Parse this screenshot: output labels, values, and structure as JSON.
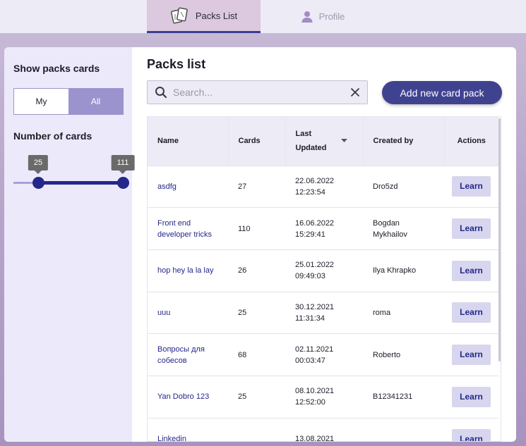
{
  "nav": {
    "tabs": [
      {
        "label": "Packs List",
        "icon": "cards-icon",
        "active": true
      },
      {
        "label": "Profile",
        "icon": "user-icon",
        "active": false
      }
    ]
  },
  "sidebar": {
    "title": "Show packs cards",
    "toggle": {
      "my": "My",
      "all": "All",
      "selected": "All"
    },
    "cards_title": "Number of cards",
    "range": {
      "min": 25,
      "max": 111,
      "min_label": "25",
      "max_label": "111",
      "scale_min": 0,
      "scale_max": 111
    }
  },
  "main": {
    "title": "Packs list",
    "search": {
      "placeholder": "Search..."
    },
    "add_button": "Add new card pack"
  },
  "table": {
    "headers": {
      "name": "Name",
      "cards": "Cards",
      "updated": "Last Updated",
      "created_by": "Created by",
      "actions": "Actions"
    },
    "rows": [
      {
        "name": "asdfg",
        "cards": "27",
        "date": "22.06.2022",
        "time": "12:23:54",
        "created_by": "Dro5zd",
        "action": "Learn"
      },
      {
        "name": "Front end developer tricks",
        "cards": "110",
        "date": "16.06.2022",
        "time": "15:29:41",
        "created_by": "Bogdan Mykhailov",
        "action": "Learn"
      },
      {
        "name": "hop hey la la lay",
        "cards": "26",
        "date": "25.01.2022",
        "time": "09:49:03",
        "created_by": "Ilya Khrapko",
        "action": "Learn"
      },
      {
        "name": "uuu",
        "cards": "25",
        "date": "30.12.2021",
        "time": "11:31:34",
        "created_by": "roma",
        "action": "Learn"
      },
      {
        "name": "Вопросы для собесов",
        "cards": "68",
        "date": "02.11.2021",
        "time": "00:03:47",
        "created_by": "Roberto",
        "action": "Learn"
      },
      {
        "name": "Yan Dobro 123",
        "cards": "25",
        "date": "08.10.2021",
        "time": "12:52:00",
        "created_by": "B12341231",
        "action": "Learn"
      },
      {
        "name": "Linkedin",
        "cards": "",
        "date": "13.08.2021",
        "time": "",
        "created_by": "",
        "action": "Learn"
      }
    ]
  },
  "colors": {
    "accent": "#24278a",
    "button": "#3f438f",
    "toggle_selected": "#9a93cd",
    "active_tab": "#dcc8df"
  }
}
